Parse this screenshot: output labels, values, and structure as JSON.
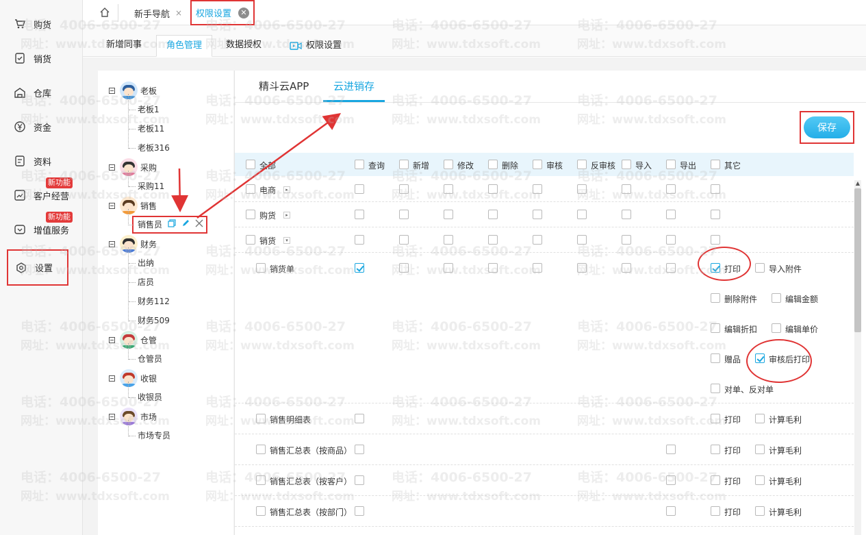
{
  "sidebar": {
    "items": [
      {
        "label": "购货",
        "icon": "cart-icon"
      },
      {
        "label": "销货",
        "icon": "sales-doc-icon"
      },
      {
        "label": "仓库",
        "icon": "warehouse-icon"
      },
      {
        "label": "资金",
        "icon": "yen-icon"
      },
      {
        "label": "资料",
        "icon": "file-icon"
      },
      {
        "label": "客户经营",
        "icon": "chart-icon",
        "badge": "新功能"
      },
      {
        "label": "增值服务",
        "icon": "service-icon",
        "badge": "新功能"
      },
      {
        "label": "设置",
        "icon": "settings-icon",
        "active": true
      }
    ]
  },
  "tabs": {
    "home_icon": "home-icon",
    "items": [
      {
        "label": "新手导航",
        "close": "×"
      },
      {
        "label": "权限设置",
        "close": "✕",
        "active": true
      }
    ]
  },
  "subtabs": {
    "items": [
      {
        "label": "新增同事"
      },
      {
        "label": "角色管理",
        "active": true
      },
      {
        "label": "数据授权"
      },
      {
        "label": "权限设置",
        "icon": "video-icon"
      }
    ]
  },
  "tree": {
    "groups": [
      {
        "name": "老板",
        "children": [
          "老板1",
          "老板11",
          "老板316"
        ],
        "color": "#3a8fd8"
      },
      {
        "name": "采购",
        "children": [
          "采购11"
        ],
        "color": "#e27a9a"
      },
      {
        "name": "销售",
        "children": [
          "销售员"
        ],
        "color": "#f29a3a"
      },
      {
        "name": "财务",
        "children": [
          "出纳",
          "店员",
          "财务112",
          "财务509"
        ],
        "color": "#f2c23a"
      },
      {
        "name": "仓管",
        "children": [
          "仓管员"
        ],
        "color": "#3aa873"
      },
      {
        "name": "收银",
        "children": [
          "收银员"
        ],
        "color": "#4aa3e8"
      },
      {
        "name": "市场",
        "children": [
          "市场专员"
        ],
        "color": "#9b7ad8"
      }
    ],
    "selected": "销售员"
  },
  "panel": {
    "tabs": [
      "精斗云APP",
      "云进销存"
    ],
    "active_tab": "云进销存",
    "save_label": "保存",
    "header": {
      "all": "全部",
      "columns": [
        "查询",
        "新增",
        "修改",
        "删除",
        "审核",
        "反审核",
        "导入",
        "导出",
        "其它"
      ]
    },
    "categories": [
      {
        "name": "电商",
        "expander": "▸"
      },
      {
        "name": "购货",
        "expander": "▸"
      },
      {
        "name": "销货",
        "expander": "▾"
      }
    ],
    "sales_order": {
      "name": "销货单",
      "query_checked": true,
      "others": [
        {
          "label": "打印",
          "checked": true
        },
        {
          "label": "导入附件",
          "checked": false
        },
        {
          "label": "删除附件",
          "checked": false
        },
        {
          "label": "编辑金额",
          "checked": false
        },
        {
          "label": "编辑折扣",
          "checked": false
        },
        {
          "label": "编辑单价",
          "checked": false
        },
        {
          "label": "赠品",
          "checked": false
        },
        {
          "label": "审核后打印",
          "checked": true
        },
        {
          "label": "对单、反对单",
          "checked": false
        }
      ]
    },
    "reports": [
      {
        "name": "销售明细表",
        "other1": "打印",
        "other2": "计算毛利",
        "has_export": false
      },
      {
        "name": "销售汇总表（按商品）",
        "other1": "打印",
        "other2": "计算毛利",
        "has_export": true
      },
      {
        "name": "销售汇总表（按客户）",
        "other1": "打印",
        "other2": "计算毛利",
        "has_export": true
      },
      {
        "name": "销售汇总表（按部门）",
        "other1": "打印",
        "other2": "计算毛利",
        "has_export": true
      }
    ]
  },
  "watermark": {
    "phone": "电话：4006-6500-27",
    "site": "网址：www.tdxsoft.com"
  },
  "colors": {
    "accent": "#18a6e0",
    "annotation": "#e03434",
    "badge": "#e33b3b"
  }
}
